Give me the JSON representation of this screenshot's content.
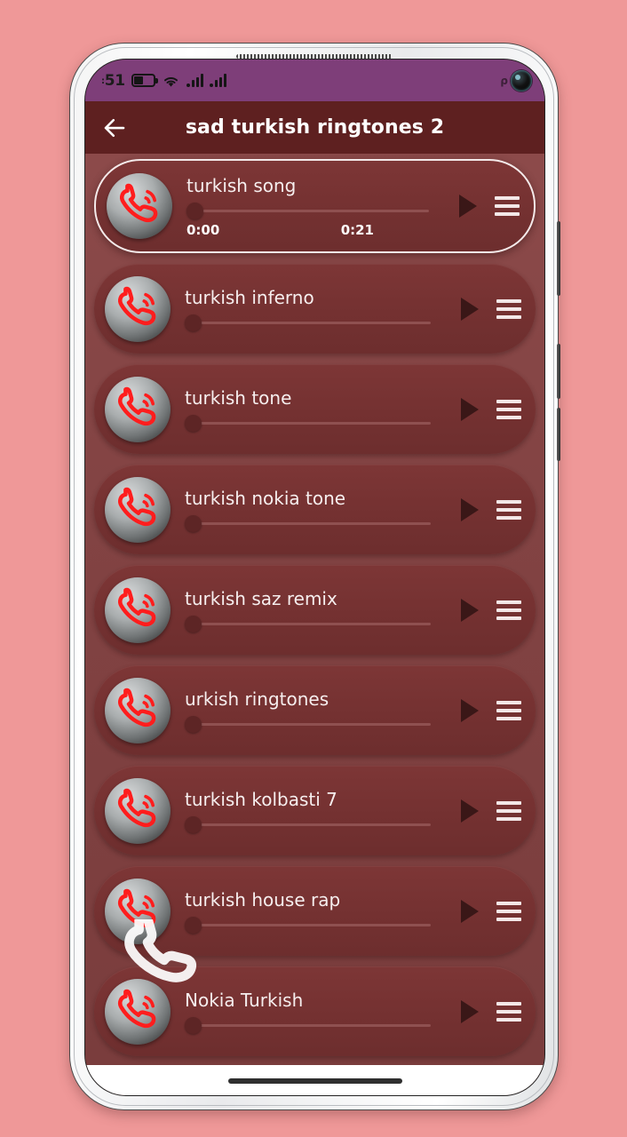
{
  "background_color": "#ef9898",
  "statusbar": {
    "clock": "51",
    "clock_prefix": ":",
    "battery_icon": "battery-icon",
    "wifi_icon": "wifi-icon",
    "signal_icon_1": "signal-bars-icon",
    "signal_icon_2": "signal-bars-icon",
    "right_glyph": "ρ",
    "camera_icon": "front-camera-punch-hole"
  },
  "appbar": {
    "back_icon": "back-arrow-icon",
    "title": "sad turkish ringtones 2",
    "bg_color": "#5e2020"
  },
  "list": {
    "thumb_icon": "ringing-phone-icon",
    "play_icon": "play-icon",
    "menu_icon": "hamburger-menu-icon",
    "items": [
      {
        "title": "turkish song",
        "selected": true,
        "progress": 0,
        "current_time": "0:00",
        "total_time": "0:21"
      },
      {
        "title": "turkish inferno",
        "selected": false,
        "progress": 0
      },
      {
        "title": "turkish tone",
        "selected": false,
        "progress": 0
      },
      {
        "title": "turkish nokia tone",
        "selected": false,
        "progress": 0
      },
      {
        "title": "turkish saz remix",
        "selected": false,
        "progress": 0
      },
      {
        "title": "urkish ringtones",
        "selected": false,
        "progress": 0
      },
      {
        "title": "turkish kolbasti 7",
        "selected": false,
        "progress": 0
      },
      {
        "title": "turkish house rap",
        "selected": false,
        "progress": 0
      },
      {
        "title": "Nokia Turkish",
        "selected": false,
        "progress": 0
      }
    ]
  },
  "watermark": {
    "icon": "phone-handset-watermark-icon"
  },
  "navbar": {
    "gesture_pill": "home-gesture-pill"
  },
  "hardware": {
    "speaker": "earpiece-speaker-grille",
    "power_button": "power-button",
    "volume_up_button": "volume-up-button",
    "volume_down_button": "volume-down-button"
  }
}
